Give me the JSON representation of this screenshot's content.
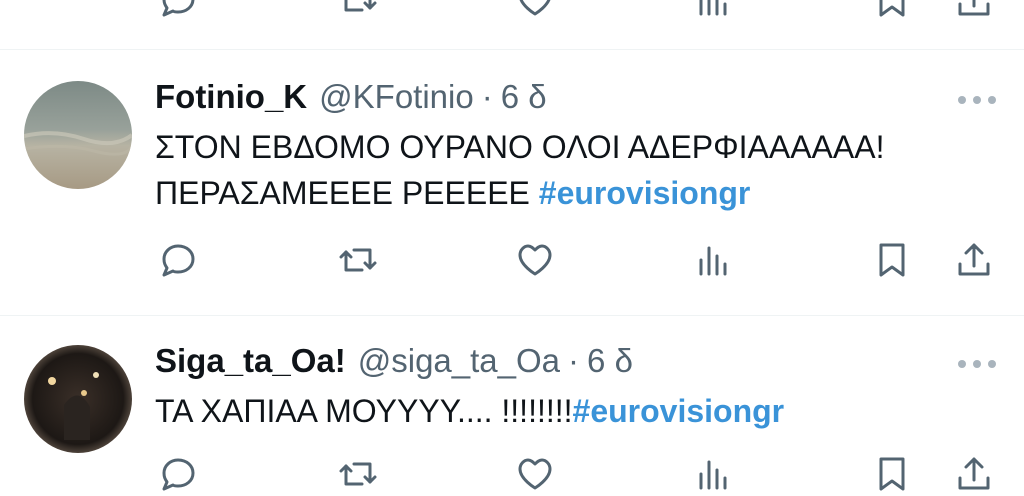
{
  "tweets": [
    {
      "display_name": "Fotinio_K",
      "handle": "@KFotinio",
      "separator": "·",
      "time": "6 δ",
      "line1": "ΣΤΟΝ ΕΒΔΟΜΟ ΟΥΡΑΝΟ ΟΛΟΙ ΑΔΕΡΦΙΑΑΑΑΑΑ!",
      "line2_text": "ΠΕΡΑΣΑΜΕΕΕΕ ΡΕΕΕΕΕ ",
      "hashtag": "#eurovisiongr"
    },
    {
      "display_name": "Siga_ta_Oa!",
      "handle": "@siga_ta_Oa",
      "separator": "·",
      "time": "6 δ",
      "line1_text": "ΤΑ ΧΑΠΙΑΑ ΜΟΥΥΥΥ.... !!!!!!!!",
      "hashtag": "#eurovisiongr"
    }
  ],
  "icons": [
    "reply-icon",
    "retweet-icon",
    "like-icon",
    "views-icon",
    "bookmark-icon",
    "share-icon",
    "more-icon"
  ],
  "colors": {
    "text": "#0f1419",
    "secondary": "#536471",
    "hashtag": "#3a93d8",
    "divider": "#eff3f4"
  }
}
